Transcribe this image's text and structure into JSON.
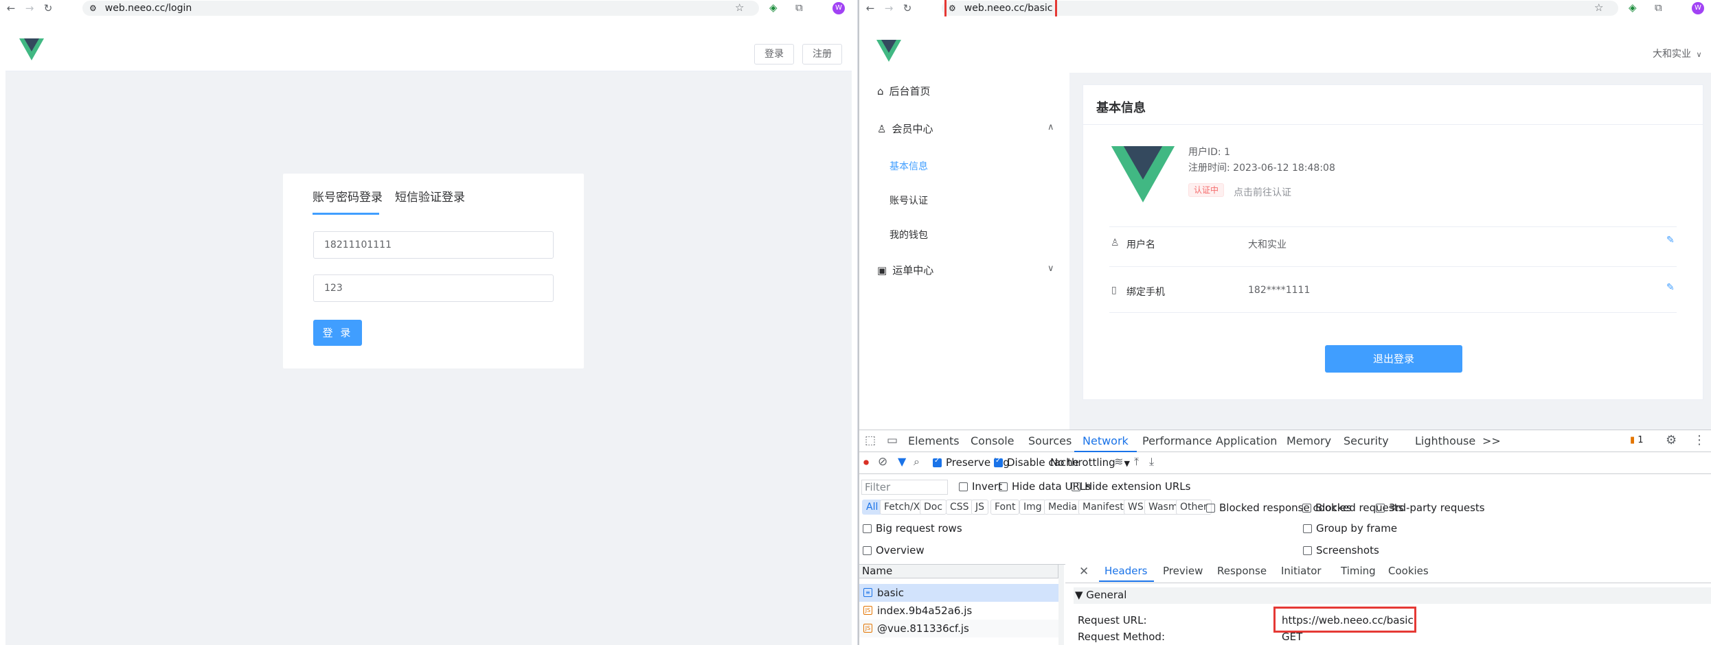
{
  "left_window": {
    "url": "web.neeo.cc/login",
    "header": {
      "login_label": "登录",
      "register_label": "注册"
    },
    "tabs": [
      {
        "label": "账号密码登录",
        "active": true
      },
      {
        "label": "短信验证登录",
        "active": false
      }
    ],
    "phone_value": "18211101111",
    "password_value": "123",
    "submit_label": "登 录"
  },
  "right_window": {
    "url": "web.neeo.cc/basic",
    "user_menu": "大和实业",
    "sidebar": {
      "home": "后台首页",
      "member_center": "会员中心",
      "member_items": [
        "基本信息",
        "账号认证",
        "我的钱包"
      ],
      "order_center": "运单中心"
    },
    "card": {
      "title": "基本信息",
      "user_id": "用户ID: 1",
      "register_time": "注册时间: 2023-06-12 18:48:08",
      "auth_badge": "认证中",
      "auth_link": "点击前往认证",
      "rows": [
        {
          "label": "用户名",
          "value": "大和实业"
        },
        {
          "label": "绑定手机",
          "value": "182****1111"
        }
      ],
      "logout_label": "退出登录"
    }
  },
  "devtools": {
    "tabs": [
      "Elements",
      "Console",
      "Sources",
      "Network",
      "Performance",
      "Application",
      "Memory",
      "Security",
      "Lighthouse"
    ],
    "active_tab": "Network",
    "more": ">>",
    "issues_count": "1",
    "preserve_log": "Preserve log",
    "disable_cache": "Disable cache",
    "throttling": "No throttling",
    "filter_placeholder": "Filter",
    "invert": "Invert",
    "hide_data_urls": "Hide data URLs",
    "hide_extension_urls": "Hide extension URLs",
    "type_filters": [
      "All",
      "Fetch/XHR",
      "Doc",
      "CSS",
      "JS",
      "Font",
      "Img",
      "Media",
      "Manifest",
      "WS",
      "Wasm",
      "Other"
    ],
    "blocked_response_cookies": "Blocked response cookies",
    "blocked_requests": "Blocked requests",
    "third_party": "3rd-party requests",
    "big_request_rows": "Big request rows",
    "group_by_frame": "Group by frame",
    "overview": "Overview",
    "screenshots": "Screenshots",
    "name_header": "Name",
    "requests": [
      "basic",
      "index.9b4a52a6.js",
      "@vue.811336cf.js"
    ],
    "detail_tabs": [
      "Headers",
      "Preview",
      "Response",
      "Initiator",
      "Timing",
      "Cookies"
    ],
    "general": "▼ General",
    "request_url_label": "Request URL:",
    "request_url_value": "https://web.neeo.cc/basic",
    "request_method_label": "Request Method:",
    "request_method_value": "GET"
  },
  "colors": {
    "accent": "#409eff",
    "vue_green": "#41b883",
    "vue_dark": "#34495e",
    "highlight": "#e53935"
  }
}
